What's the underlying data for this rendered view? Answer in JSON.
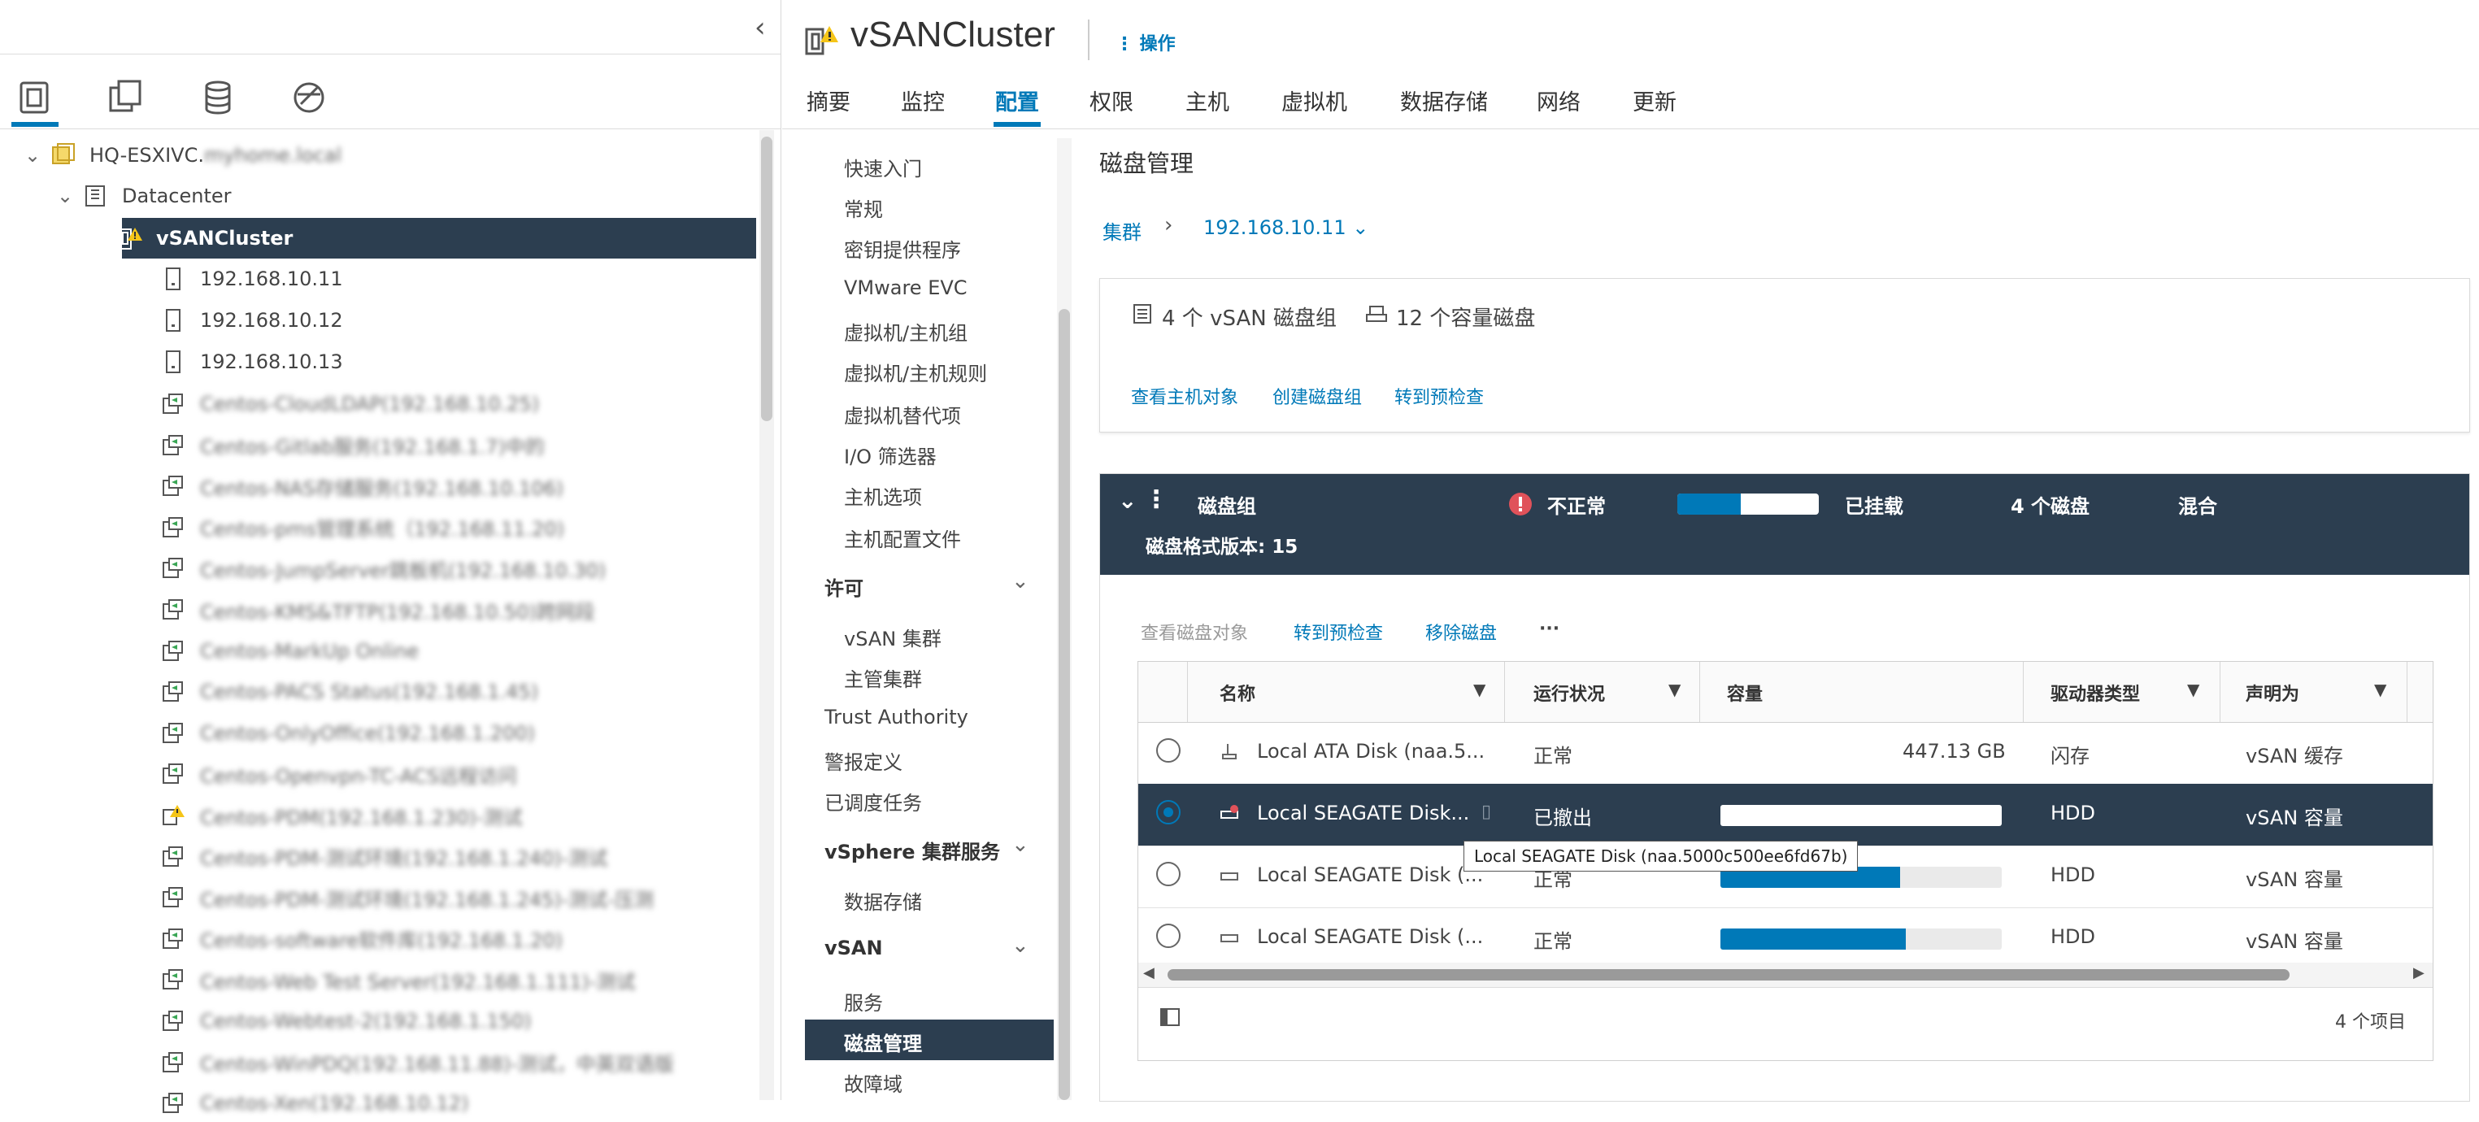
{
  "nav": {
    "tree": {
      "vcenter": "HQ-ESXIVC.myhome.local",
      "datacenter": "Datacenter",
      "cluster": "vSANCluster",
      "hosts": [
        "192.168.10.11",
        "192.168.10.12",
        "192.168.10.13"
      ],
      "vms": [
        "Centos-CloudLDAP(192.168.10.25)",
        "Centos-Gitlab服务(192.168.1.7)中的",
        "Centos-NAS存储服务(192.168.10.106)",
        "Centos-pms管理系统（192.168.11.20)",
        "Centos-JumpServer跳板机(192.168.10.30)",
        "Centos-KMS&TFTP(192.168.10.50)跨网段",
        "Centos-MarkUp Online",
        "Centos-PACS Status(192.168.1.45)",
        "Centos-OnlyOffice(192.168.1.200)",
        "Centos-Openvpn-TC-ACS远程访问",
        "Centos-PDM(192.168.1.230)-测试",
        "Centos-PDM-测试环境(192.168.1.240)-测试",
        "Centos-PDM-测试环境(192.168.1.245)-测试-压测",
        "Centos-software软件库(192.168.1.20)",
        "Centos-Web Test Server(192.168.1.111)-测试",
        "Centos-Webtest-2(192.168.1.150)",
        "Centos-WinPDQ(192.168.11.88)-测试，中英双语版",
        "Centos-Xen(192.168.10.12)"
      ]
    }
  },
  "header": {
    "title": "vSANCluster",
    "actions_label": "操作",
    "tabs": [
      "摘要",
      "监控",
      "配置",
      "权限",
      "主机",
      "虚拟机",
      "数据存储",
      "网络",
      "更新"
    ]
  },
  "subnav": {
    "items_top": [
      "快速入门",
      "常规",
      "密钥提供程序",
      "VMware EVC",
      "虚拟机/主机组",
      "虚拟机/主机规则",
      "虚拟机替代项",
      "I/O 筛选器",
      "主机选项",
      "主机配置文件"
    ],
    "license_head": "许可",
    "license_items": [
      "vSAN 集群",
      "主管集群"
    ],
    "trust": "Trust Authority",
    "alarms": "警报定义",
    "tasks": "已调度任务",
    "vsphere_head": "vSphere 集群服务",
    "vsphere_items": [
      "数据存储"
    ],
    "vsan_head": "vSAN",
    "vsan_items": [
      "服务",
      "磁盘管理",
      "故障域"
    ]
  },
  "main": {
    "page_title": "磁盘管理",
    "breadcrumb": {
      "cluster": "集群",
      "host": "192.168.10.11"
    },
    "summary": {
      "disk_groups": "4 个 vSAN 磁盘组",
      "capacity_disks": "12 个容量磁盘",
      "links": [
        "查看主机对象",
        "创建磁盘组",
        "转到预检查"
      ]
    },
    "disk_group": {
      "label": "磁盘组",
      "health": "不正常",
      "usage_fraction": 0.45,
      "mount": "已挂载",
      "disk_count": "4 个磁盘",
      "type": "混合",
      "format_version": "磁盘格式版本: 15",
      "actions": {
        "view": "查看磁盘对象",
        "precheck": "转到预检查",
        "remove": "移除磁盘",
        "more": "···"
      }
    },
    "grid": {
      "columns": [
        "名称",
        "运行状况",
        "容量",
        "驱动器类型",
        "声明为"
      ],
      "rows": [
        {
          "name": "Local ATA Disk (naa.5...",
          "status": "正常",
          "capacity": "447.13 GB",
          "capacity_fraction": null,
          "drive": "闪存",
          "claimed": "vSAN 缓存",
          "selected": false
        },
        {
          "name": "Local SEAGATE Disk...",
          "status": "已撤出",
          "capacity": "",
          "capacity_fraction": 0.0,
          "drive": "HDD",
          "claimed": "vSAN 容量",
          "selected": true
        },
        {
          "name": "Local SEAGATE Disk (...",
          "status": "正常",
          "capacity": "",
          "capacity_fraction": 0.64,
          "drive": "HDD",
          "claimed": "vSAN 容量",
          "selected": false
        },
        {
          "name": "Local SEAGATE Disk (...",
          "status": "正常",
          "capacity": "",
          "capacity_fraction": 0.66,
          "drive": "HDD",
          "claimed": "vSAN 容量",
          "selected": false
        }
      ],
      "footer_count": "4 个项目"
    },
    "tooltip": "Local SEAGATE Disk (naa.5000c500ee6fd67b)"
  },
  "colors": {
    "accent": "#0079b8",
    "selected_bg": "#2c3e50",
    "alert": "#e0525a"
  }
}
